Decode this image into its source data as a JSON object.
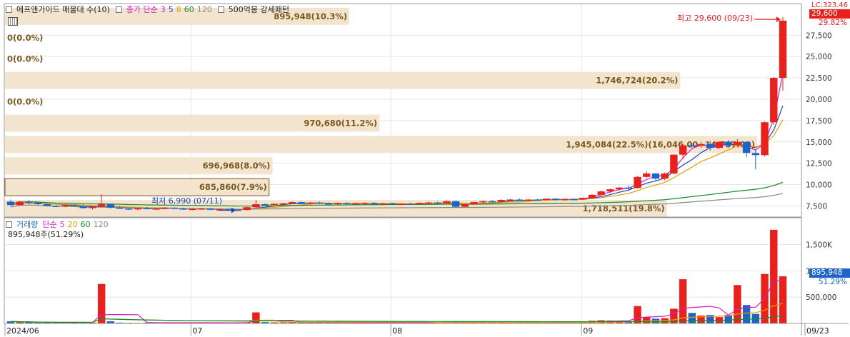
{
  "legend_price": {
    "title": "에프앤가이드 매물대 수(10)",
    "ma_title": "종가 단순",
    "ma_periods": [
      "3",
      "5",
      "8",
      "60",
      "120"
    ],
    "ma_colors": [
      "#d11ec2",
      "#1f3fbf",
      "#e0a000",
      "#1a8a2a",
      "#888888"
    ],
    "pattern": "500억봉 강세패턴"
  },
  "legend_volume": {
    "title": "거래량",
    "ma_title": "단순",
    "ma_periods": [
      "5",
      "20",
      "60",
      "120"
    ],
    "ma_colors": [
      "#d11ec2",
      "#e0a000",
      "#1a8a2a",
      "#888888"
    ],
    "current": "895,948주(51.29%)"
  },
  "annotations": {
    "high": "최고 29,600 (09/23)",
    "low": "최저 6,990 (07/11)"
  },
  "right_axis_tags": {
    "top": "LC:323.46",
    "price": "29,600",
    "price_pct": "29.82%",
    "volume": "895,948",
    "volume_pct": "51.29%"
  },
  "colors": {
    "up": "#e8211c",
    "down": "#1e63c8",
    "volume_profile": "#f3e4d0",
    "volume_profile_text": "#7a5a1a",
    "grid": "#e4e4e4"
  },
  "chart_data": {
    "type": "candlestick",
    "x_ticks": [
      "2024/06",
      "07",
      "08",
      "09",
      "09/23"
    ],
    "price_axis": {
      "ylim": [
        6200,
        31200
      ],
      "ticks": [
        7500,
        10000,
        12500,
        15000,
        17500,
        20000,
        22500,
        25000,
        27500
      ],
      "tick_labels": [
        "7,500",
        "10,000",
        "12,500",
        "15,000",
        "17,500",
        "20,000",
        "22,500",
        "25,000",
        "27,500"
      ]
    },
    "volume_axis": {
      "ylim": [
        0,
        1900000
      ],
      "ticks": [
        500000,
        1000000,
        1500000
      ],
      "tick_labels": [
        "500,000",
        "1,000K",
        "1,500K"
      ]
    },
    "volume_profile": [
      {
        "low": 6200,
        "high": 8200,
        "label": "1,718,511(19.8%)",
        "pct": 19.8
      },
      {
        "low": 8700,
        "high": 10700,
        "label": "685,860(7.9%)",
        "pct": 7.9
      },
      {
        "low": 11200,
        "high": 13200,
        "label": "696,968(8.0%)",
        "pct": 8.0
      },
      {
        "low": 13700,
        "high": 15700,
        "label": "1,945,084(22.5%)(16,046.00~14,787.00)",
        "pct": 22.5
      },
      {
        "low": 16200,
        "high": 18200,
        "label": "970,680(11.2%)",
        "pct": 11.2
      },
      {
        "low": 18700,
        "high": 20700,
        "label": "0(0.0%)",
        "pct": 0
      },
      {
        "low": 21200,
        "high": 23200,
        "label": "1,746,724(20.2%)",
        "pct": 20.2
      },
      {
        "low": 23700,
        "high": 25700,
        "label": "0(0.0%)",
        "pct": 0
      },
      {
        "low": 26200,
        "high": 28200,
        "label": "0(0.0%)",
        "pct": 0
      },
      {
        "low": 28700,
        "high": 30700,
        "label": "895,948(10.3%)",
        "pct": 10.3
      }
    ],
    "candles": [
      {
        "o": 8000,
        "h": 8250,
        "l": 7500,
        "c": 7600,
        "v": 40000
      },
      {
        "o": 7600,
        "h": 8100,
        "l": 7550,
        "c": 8000,
        "v": 25000
      },
      {
        "o": 8000,
        "h": 8200,
        "l": 7700,
        "c": 7900,
        "v": 20000
      },
      {
        "o": 7900,
        "h": 7950,
        "l": 7600,
        "c": 7700,
        "v": 15000
      },
      {
        "o": 7700,
        "h": 7800,
        "l": 7450,
        "c": 7500,
        "v": 20000
      },
      {
        "o": 7500,
        "h": 7600,
        "l": 7350,
        "c": 7450,
        "v": 15000
      },
      {
        "o": 7450,
        "h": 7700,
        "l": 7350,
        "c": 7600,
        "v": 22000
      },
      {
        "o": 7600,
        "h": 7700,
        "l": 7400,
        "c": 7500,
        "v": 20000
      },
      {
        "o": 7500,
        "h": 7650,
        "l": 7200,
        "c": 7250,
        "v": 18000
      },
      {
        "o": 7250,
        "h": 7500,
        "l": 7100,
        "c": 7400,
        "v": 15000
      },
      {
        "o": 7400,
        "h": 8900,
        "l": 7350,
        "c": 7700,
        "v": 750000
      },
      {
        "o": 7700,
        "h": 7750,
        "l": 7200,
        "c": 7300,
        "v": 40000
      },
      {
        "o": 7300,
        "h": 7500,
        "l": 7150,
        "c": 7200,
        "v": 15000
      },
      {
        "o": 7200,
        "h": 7250,
        "l": 7000,
        "c": 7100,
        "v": 12000
      },
      {
        "o": 7100,
        "h": 7300,
        "l": 7000,
        "c": 7250,
        "v": 10000
      },
      {
        "o": 7250,
        "h": 7400,
        "l": 7100,
        "c": 7150,
        "v": 15000
      },
      {
        "o": 7150,
        "h": 7300,
        "l": 7050,
        "c": 7200,
        "v": 18000
      },
      {
        "o": 7200,
        "h": 7350,
        "l": 7100,
        "c": 7300,
        "v": 12000
      },
      {
        "o": 7300,
        "h": 7350,
        "l": 7100,
        "c": 7200,
        "v": 12000
      },
      {
        "o": 7200,
        "h": 7300,
        "l": 7050,
        "c": 7100,
        "v": 15000
      },
      {
        "o": 7100,
        "h": 7250,
        "l": 7000,
        "c": 7150,
        "v": 12000
      },
      {
        "o": 7150,
        "h": 7300,
        "l": 7050,
        "c": 7200,
        "v": 15000
      },
      {
        "o": 7200,
        "h": 7250,
        "l": 7000,
        "c": 7050,
        "v": 12000
      },
      {
        "o": 7050,
        "h": 7200,
        "l": 6990,
        "c": 7100,
        "v": 14000
      },
      {
        "o": 7100,
        "h": 7200,
        "l": 7000,
        "c": 7050,
        "v": 12000
      },
      {
        "o": 7050,
        "h": 7100,
        "l": 6990,
        "c": 7030,
        "v": 10000
      },
      {
        "o": 7030,
        "h": 7400,
        "l": 7000,
        "c": 7350,
        "v": 18000
      },
      {
        "o": 7350,
        "h": 8200,
        "l": 7300,
        "c": 7700,
        "v": 210000
      },
      {
        "o": 7700,
        "h": 7800,
        "l": 7500,
        "c": 7650,
        "v": 25000
      },
      {
        "o": 7650,
        "h": 7800,
        "l": 7550,
        "c": 7750,
        "v": 20000
      },
      {
        "o": 7750,
        "h": 7850,
        "l": 7650,
        "c": 7800,
        "v": 18000
      },
      {
        "o": 7800,
        "h": 8000,
        "l": 7700,
        "c": 7950,
        "v": 22000
      },
      {
        "o": 7950,
        "h": 8000,
        "l": 7700,
        "c": 7750,
        "v": 18000
      },
      {
        "o": 7750,
        "h": 7950,
        "l": 7650,
        "c": 7900,
        "v": 20000
      },
      {
        "o": 7900,
        "h": 8000,
        "l": 7750,
        "c": 7800,
        "v": 18000
      },
      {
        "o": 7800,
        "h": 7900,
        "l": 7650,
        "c": 7700,
        "v": 15000
      },
      {
        "o": 7700,
        "h": 7900,
        "l": 7650,
        "c": 7850,
        "v": 18000
      },
      {
        "o": 7850,
        "h": 7950,
        "l": 7700,
        "c": 7750,
        "v": 15000
      },
      {
        "o": 7750,
        "h": 7900,
        "l": 7650,
        "c": 7800,
        "v": 14000
      },
      {
        "o": 7800,
        "h": 7950,
        "l": 7700,
        "c": 7850,
        "v": 15000
      },
      {
        "o": 7850,
        "h": 7950,
        "l": 7650,
        "c": 7700,
        "v": 16000
      },
      {
        "o": 7700,
        "h": 7850,
        "l": 7600,
        "c": 7800,
        "v": 14000
      },
      {
        "o": 7800,
        "h": 7900,
        "l": 7650,
        "c": 7700,
        "v": 13000
      },
      {
        "o": 7700,
        "h": 7800,
        "l": 7600,
        "c": 7750,
        "v": 12000
      },
      {
        "o": 7750,
        "h": 7850,
        "l": 7650,
        "c": 7700,
        "v": 12000
      },
      {
        "o": 7700,
        "h": 7900,
        "l": 7650,
        "c": 7850,
        "v": 18000
      },
      {
        "o": 7850,
        "h": 8000,
        "l": 7750,
        "c": 7900,
        "v": 15000
      },
      {
        "o": 7900,
        "h": 8000,
        "l": 7750,
        "c": 7800,
        "v": 14000
      },
      {
        "o": 7800,
        "h": 8150,
        "l": 7750,
        "c": 8050,
        "v": 30000
      },
      {
        "o": 8050,
        "h": 8150,
        "l": 7300,
        "c": 7400,
        "v": 40000
      },
      {
        "o": 7400,
        "h": 7750,
        "l": 7350,
        "c": 7700,
        "v": 20000
      },
      {
        "o": 7700,
        "h": 8000,
        "l": 7650,
        "c": 7950,
        "v": 18000
      },
      {
        "o": 7950,
        "h": 8150,
        "l": 7850,
        "c": 8050,
        "v": 20000
      },
      {
        "o": 8050,
        "h": 8200,
        "l": 7950,
        "c": 8000,
        "v": 18000
      },
      {
        "o": 8000,
        "h": 8300,
        "l": 7950,
        "c": 8200,
        "v": 22000
      },
      {
        "o": 8200,
        "h": 8350,
        "l": 8100,
        "c": 8250,
        "v": 20000
      },
      {
        "o": 8250,
        "h": 8400,
        "l": 8050,
        "c": 8100,
        "v": 18000
      },
      {
        "o": 8100,
        "h": 8300,
        "l": 8000,
        "c": 8250,
        "v": 15000
      },
      {
        "o": 8250,
        "h": 8350,
        "l": 8100,
        "c": 8200,
        "v": 14000
      },
      {
        "o": 8200,
        "h": 8400,
        "l": 8100,
        "c": 8350,
        "v": 16000
      },
      {
        "o": 8350,
        "h": 8400,
        "l": 8150,
        "c": 8200,
        "v": 14000
      },
      {
        "o": 8200,
        "h": 8350,
        "l": 8100,
        "c": 8300,
        "v": 15000
      },
      {
        "o": 8300,
        "h": 8400,
        "l": 8150,
        "c": 8250,
        "v": 14000
      },
      {
        "o": 8250,
        "h": 8500,
        "l": 8200,
        "c": 8450,
        "v": 25000
      },
      {
        "o": 8450,
        "h": 8900,
        "l": 8400,
        "c": 8800,
        "v": 50000
      },
      {
        "o": 8800,
        "h": 9300,
        "l": 8700,
        "c": 9200,
        "v": 60000
      },
      {
        "o": 9200,
        "h": 9550,
        "l": 9000,
        "c": 9450,
        "v": 55000
      },
      {
        "o": 9450,
        "h": 9750,
        "l": 9300,
        "c": 9650,
        "v": 50000
      },
      {
        "o": 9650,
        "h": 9900,
        "l": 9400,
        "c": 9600,
        "v": 45000
      },
      {
        "o": 9600,
        "h": 11000,
        "l": 9550,
        "c": 10900,
        "v": 330000
      },
      {
        "o": 10900,
        "h": 11550,
        "l": 10800,
        "c": 11300,
        "v": 120000
      },
      {
        "o": 11300,
        "h": 11350,
        "l": 10500,
        "c": 10700,
        "v": 90000
      },
      {
        "o": 10700,
        "h": 11400,
        "l": 10500,
        "c": 11300,
        "v": 100000
      },
      {
        "o": 11300,
        "h": 13600,
        "l": 11200,
        "c": 13500,
        "v": 280000
      },
      {
        "o": 13500,
        "h": 14800,
        "l": 13000,
        "c": 14600,
        "v": 840000
      },
      {
        "o": 14600,
        "h": 14900,
        "l": 14300,
        "c": 14550,
        "v": 200000
      },
      {
        "o": 14550,
        "h": 15000,
        "l": 14300,
        "c": 14750,
        "v": 150000
      },
      {
        "o": 14750,
        "h": 15100,
        "l": 14000,
        "c": 14300,
        "v": 160000
      },
      {
        "o": 14300,
        "h": 15100,
        "l": 14200,
        "c": 15000,
        "v": 120000
      },
      {
        "o": 15000,
        "h": 15200,
        "l": 14400,
        "c": 14600,
        "v": 160000
      },
      {
        "o": 14600,
        "h": 15300,
        "l": 14500,
        "c": 15000,
        "v": 730000
      },
      {
        "o": 15000,
        "h": 15100,
        "l": 13200,
        "c": 13700,
        "v": 350000
      },
      {
        "o": 13700,
        "h": 14000,
        "l": 11800,
        "c": 13450,
        "v": 180000
      },
      {
        "o": 13450,
        "h": 17400,
        "l": 13300,
        "c": 17300,
        "v": 940000
      },
      {
        "o": 17300,
        "h": 22600,
        "l": 17000,
        "c": 22500,
        "v": 1780000
      },
      {
        "o": 22500,
        "h": 29600,
        "l": 21000,
        "c": 29200,
        "v": 895948
      }
    ]
  }
}
